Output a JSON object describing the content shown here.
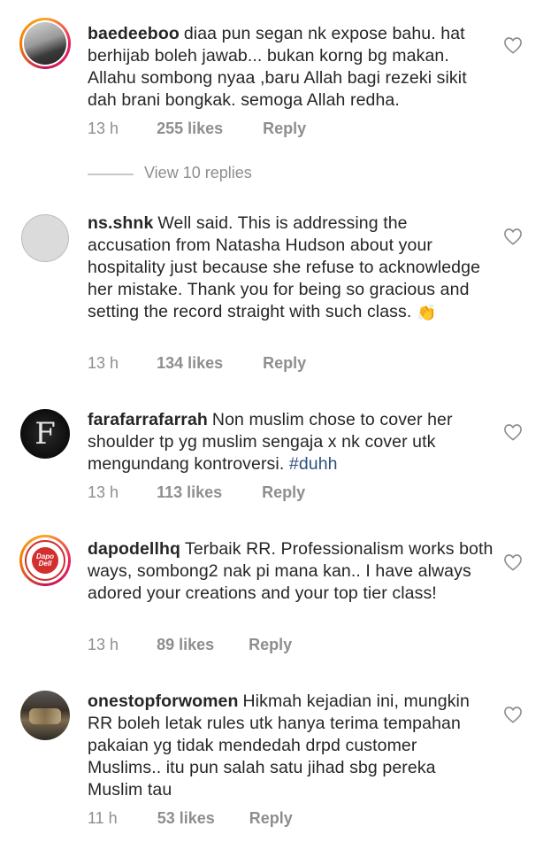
{
  "comments": [
    {
      "username": "baedeeboo",
      "text": "diaa pun segan nk expose bahu. hat berhijab boleh jawab... bukan korng bg makan. Allahu sombong nyaa ,baru Allah bagi rezeki sikit dah brani bongkak. semoga Allah redha.",
      "time": "13 h",
      "likes": "255 likes",
      "reply": "Reply",
      "view_replies": "View 10 replies"
    },
    {
      "username": "ns.shnk",
      "text": "Well said. This is addressing the accusation from Natasha Hudson about your hospitality just because she refuse to acknowledge her mistake. Thank you for being so gracious and setting the record straight with such class.",
      "emoji": "👏",
      "time": "13 h",
      "likes": "134 likes",
      "reply": "Reply"
    },
    {
      "username": "farafarrafarrah",
      "text": "Non muslim chose to cover her shoulder tp yg muslim sengaja x nk cover utk mengundang kontroversi.",
      "hashtag": "#duhh",
      "time": "13 h",
      "likes": "113 likes",
      "reply": "Reply"
    },
    {
      "username": "dapodellhq",
      "text": "Terbaik RR. Professionalism works both ways, sombong2 nak pi mana kan.. I have always adored your creations and your top tier class!",
      "time": "13 h",
      "likes": "89 likes",
      "reply": "Reply",
      "avatar_text": "Dapo Dell"
    },
    {
      "username": "onestopforwomen",
      "text": "Hikmah kejadian ini, mungkin RR boleh letak rules utk hanya terima tempahan pakaian yg tidak mendedah drpd customer Muslims.. itu pun salah satu jihad sbg pereka Muslim tau",
      "time": "11 h",
      "likes": "53 likes",
      "reply": "Reply"
    }
  ],
  "colors": {
    "text": "#262626",
    "muted": "#8e8e8e",
    "hashtag": "#2b4f7f",
    "story_ring_start": "#f9a825",
    "story_ring_end": "#c2185b"
  },
  "icons": {
    "like": "heart-outline-icon"
  }
}
